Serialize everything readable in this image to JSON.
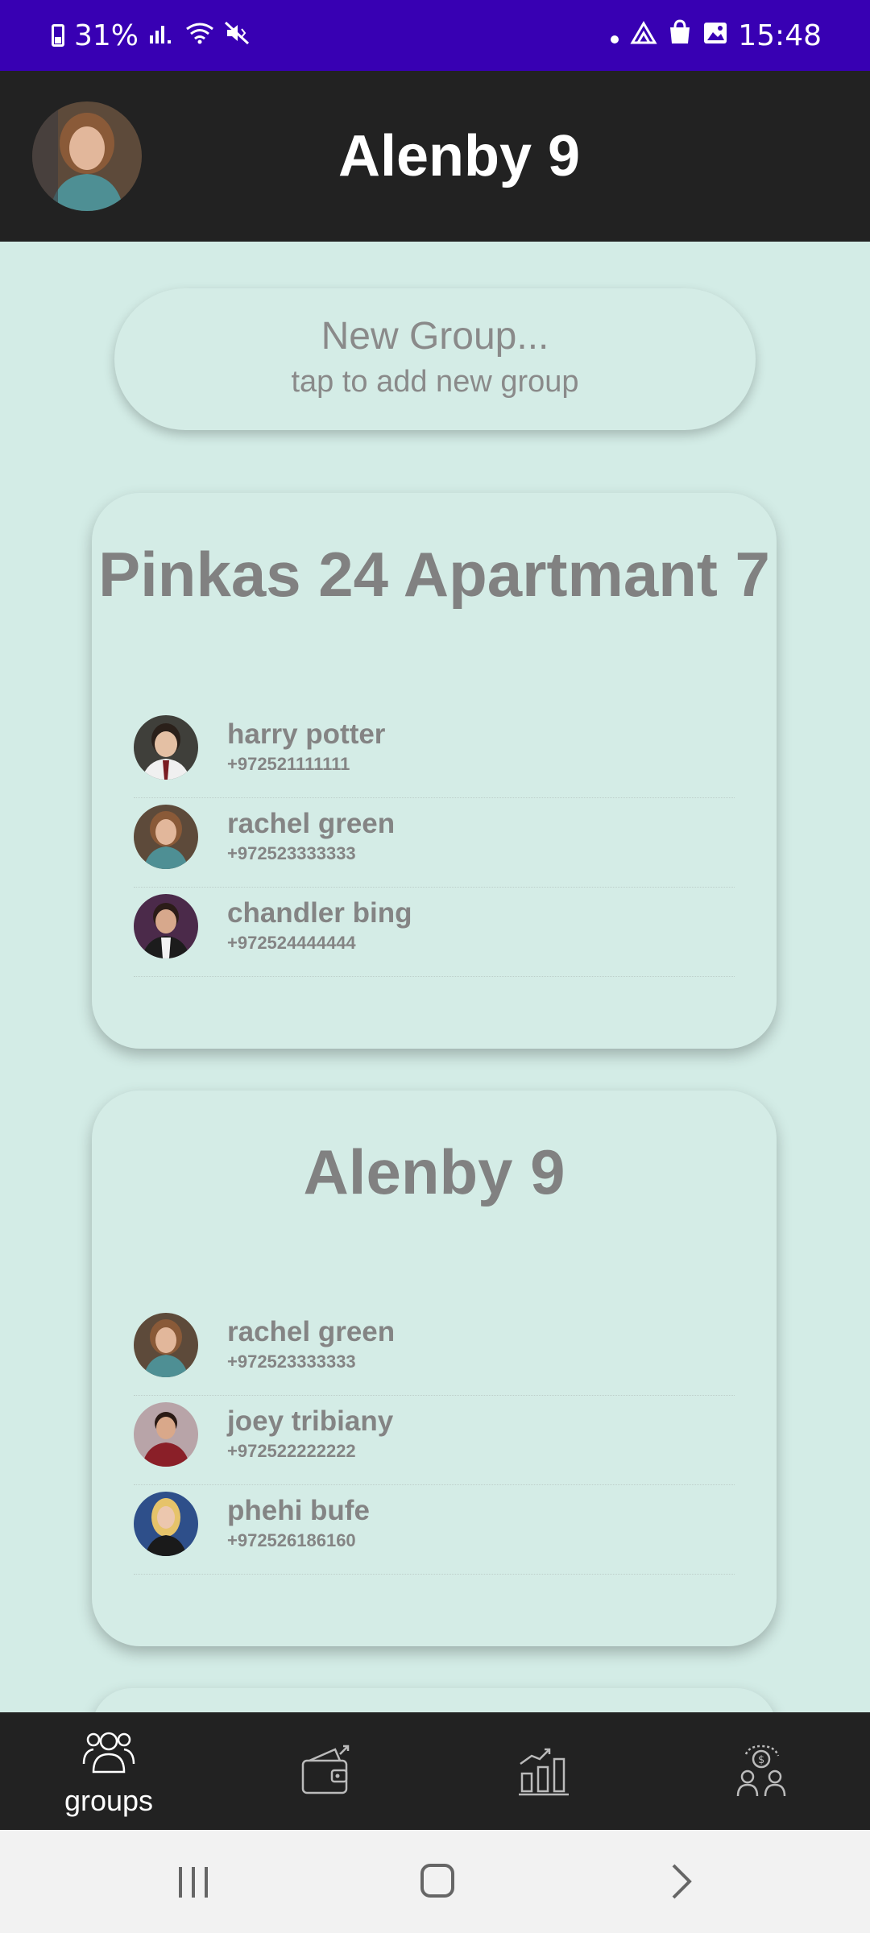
{
  "status_bar": {
    "battery": "31%",
    "time": "15:48",
    "indicators": [
      "battery-icon",
      "signal-icon",
      "wifi-icon",
      "mute-icon",
      "dot-icon",
      "drive-icon",
      "bag-icon",
      "image-icon"
    ]
  },
  "header": {
    "title": "Alenby 9",
    "avatar_icon": "profile-avatar-icon"
  },
  "new_group": {
    "title": "New Group...",
    "subtitle": "tap to add new group"
  },
  "groups": [
    {
      "name": "Pinkas 24 Apartmant 7",
      "members": [
        {
          "name": "harry potter",
          "phone": "+972521111111",
          "avatar_color": "#5a4a3c"
        },
        {
          "name": "rachel green",
          "phone": "+972523333333",
          "avatar_color": "#6f5b45"
        },
        {
          "name": "chandler bing",
          "phone": "+972524444444",
          "avatar_color": "#4b2a3a"
        }
      ]
    },
    {
      "name": "Alenby 9",
      "members": [
        {
          "name": "rachel green",
          "phone": "+972523333333",
          "avatar_color": "#6f5b45"
        },
        {
          "name": "joey tribiany",
          "phone": "+972522222222",
          "avatar_color": "#7a2730"
        },
        {
          "name": "phehi bufe",
          "phone": "+972526186160",
          "avatar_color": "#2e4f8a"
        }
      ]
    }
  ],
  "bottom_nav": {
    "items": [
      {
        "label": "groups",
        "icon": "groups-icon",
        "active": true
      },
      {
        "label": "",
        "icon": "wallet-icon",
        "active": false
      },
      {
        "label": "",
        "icon": "bar-chart-icon",
        "active": false
      },
      {
        "label": "",
        "icon": "payment-users-icon",
        "active": false
      }
    ]
  },
  "colors": {
    "status_bar": "#3800b3",
    "header_bg": "#222222",
    "content_bg": "#d3ece6",
    "card_bg": "#d4ece6",
    "text_muted": "#848484"
  }
}
